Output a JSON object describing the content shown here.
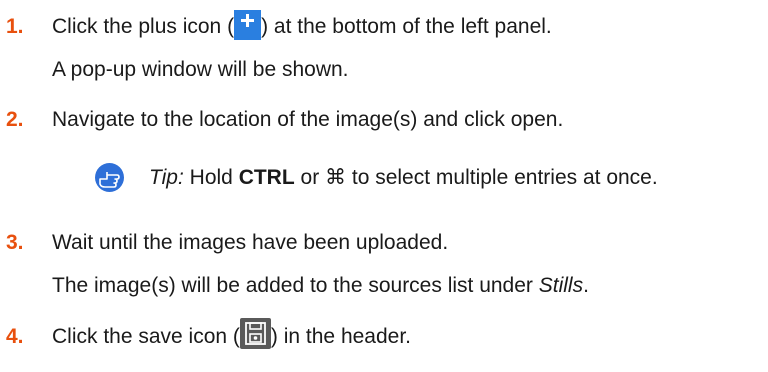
{
  "steps": [
    {
      "number": "1.",
      "text_before": "Click the plus icon (",
      "icon": "plus-icon",
      "text_after": ") at the bottom of the left panel.",
      "result": "A pop-up window will be shown."
    },
    {
      "number": "2.",
      "text": "Navigate to the location of the image(s) and click open."
    },
    {
      "number": "3.",
      "text": "Wait until the images have been uploaded.",
      "result_before": "The image(s) will be added to the sources list under ",
      "result_italic": "Stills",
      "result_after": "."
    },
    {
      "number": "4.",
      "text_before": "Click the save icon (",
      "icon": "save-icon",
      "text_after": ") in the header."
    }
  ],
  "tip": {
    "icon": "pointing-hand-icon",
    "label": "Tip:",
    "text_before": " Hold ",
    "key1": "CTRL",
    "text_mid": " or ",
    "key2": "⌘",
    "text_after": " to select multiple entries at once."
  },
  "colors": {
    "step_number": "#e8500e",
    "plus_icon_bg": "#2a7fe0",
    "save_icon_bg": "#5a5a5a",
    "tip_icon_bg": "#2e6fd8"
  }
}
